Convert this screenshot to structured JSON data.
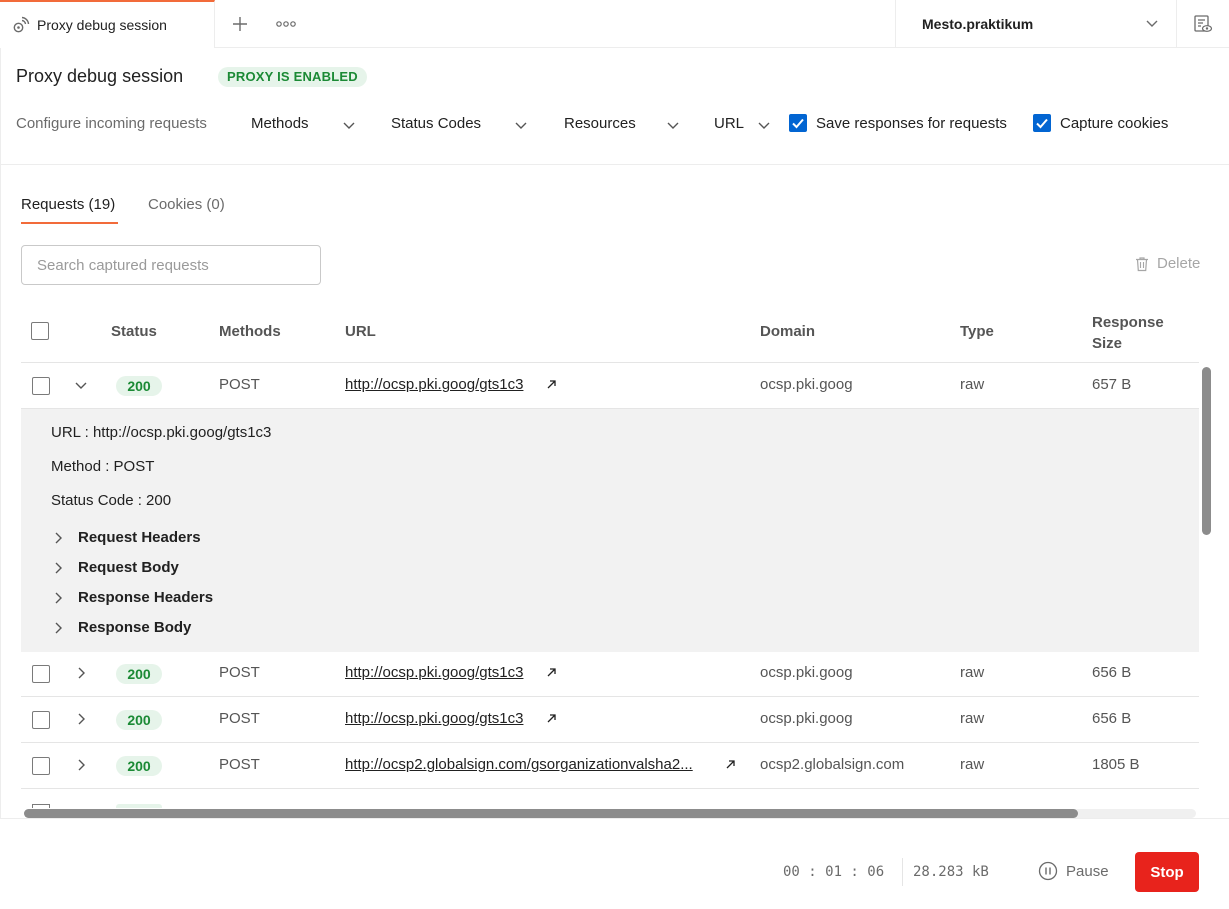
{
  "tab": {
    "title": "Proxy debug session"
  },
  "workspace": {
    "name": "Mesto.praktikum"
  },
  "header": {
    "title": "Proxy debug session",
    "badge": "PROXY IS ENABLED"
  },
  "config": {
    "label": "Configure incoming requests",
    "filters": [
      "Methods",
      "Status Codes",
      "Resources",
      "URL"
    ],
    "save_responses": {
      "label": "Save responses for requests",
      "checked": true
    },
    "capture_cookies": {
      "label": "Capture cookies",
      "checked": true
    }
  },
  "tabs": {
    "requests": "Requests (19)",
    "cookies": "Cookies (0)"
  },
  "search": {
    "placeholder": "Search captured requests"
  },
  "delete_label": "Delete",
  "columns": {
    "status": "Status",
    "methods": "Methods",
    "url": "URL",
    "domain": "Domain",
    "type": "Type",
    "size_line1": "Response",
    "size_line2": "Size"
  },
  "rows": [
    {
      "status": "200",
      "method": "POST",
      "url": "http://ocsp.pki.goog/gts1c3",
      "domain": "ocsp.pki.goog",
      "type": "raw",
      "size": "657 B",
      "expanded": true
    },
    {
      "status": "200",
      "method": "POST",
      "url": "http://ocsp.pki.goog/gts1c3",
      "domain": "ocsp.pki.goog",
      "type": "raw",
      "size": "656 B"
    },
    {
      "status": "200",
      "method": "POST",
      "url": "http://ocsp.pki.goog/gts1c3",
      "domain": "ocsp.pki.goog",
      "type": "raw",
      "size": "656 B"
    },
    {
      "status": "200",
      "method": "POST",
      "url": "http://ocsp2.globalsign.com/gsorganizationvalsha2...",
      "domain": "ocsp2.globalsign.com",
      "type": "raw",
      "size": "1805 B"
    }
  ],
  "details": {
    "url_line": "URL : http://ocsp.pki.goog/gts1c3",
    "method_line": "Method : POST",
    "status_line": "Status Code : 200",
    "sections": [
      "Request Headers",
      "Request Body",
      "Response Headers",
      "Response Body"
    ]
  },
  "footer": {
    "timer": "00 : 01 : 06",
    "size": "28.283 kB",
    "pause": "Pause",
    "stop": "Stop"
  }
}
